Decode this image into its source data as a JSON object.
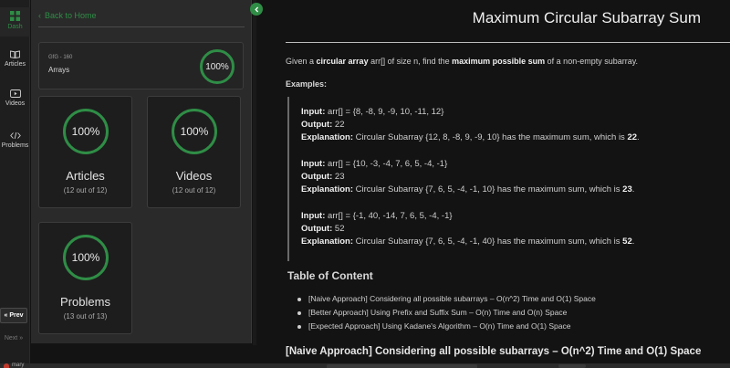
{
  "rail": {
    "items": [
      {
        "label": "Dash",
        "icon": "grid-icon"
      },
      {
        "label": "Articles",
        "icon": "book-icon"
      },
      {
        "label": "Videos",
        "icon": "play-icon"
      },
      {
        "label": "Problems",
        "icon": "code-icon"
      }
    ],
    "prev_label": "Prev",
    "next_label": "Next"
  },
  "panel": {
    "back_label": "Back to Home",
    "course": {
      "code": "GfG - 160",
      "name": "Arrays",
      "progress": "100%"
    },
    "stats": [
      {
        "progress": "100%",
        "title": "Articles",
        "subtitle": "(12 out of 12)"
      },
      {
        "progress": "100%",
        "title": "Videos",
        "subtitle": "(12 out of 12)"
      },
      {
        "progress": "100%",
        "title": "Problems",
        "subtitle": "(13 out of 13)"
      }
    ]
  },
  "article": {
    "title": "Maximum Circular Subarray Sum",
    "intro": {
      "p1": "Given a ",
      "b1": "circular array",
      "p2": " arr[] of size n, find the ",
      "b2": "maximum possible sum",
      "p3": " of a non-empty subarray."
    },
    "examples_label": "Examples:",
    "examples": [
      {
        "input_label": "Input:",
        "input": " arr[] = {8, -8, 9, -9, 10, -11, 12}",
        "output_label": "Output:",
        "output": " 22",
        "explanation_label": "Explanation:",
        "explanation": " Circular Subarray {12, 8, -8, 9, -9, 10} has the maximum sum, which is ",
        "answer": "22",
        "end": "."
      },
      {
        "input_label": "Input:",
        "input": " arr[] = {10, -3, -4, 7, 6, 5, -4, -1}",
        "output_label": "Output:",
        "output": " 23",
        "explanation_label": "Explanation:",
        "explanation": " Circular Subarray {7, 6, 5, -4, -1, 10} has the maximum sum, which is ",
        "answer": "23",
        "end": "."
      },
      {
        "input_label": "Input:",
        "input": " arr[] = {-1, 40, -14, 7, 6, 5, -4, -1}",
        "output_label": "Output:",
        "output": " 52",
        "explanation_label": "Explanation:",
        "explanation": " Circular Subarray {7, 6, 5, -4, -1, 40} has the maximum sum, which is ",
        "answer": "52",
        "end": "."
      }
    ],
    "toc_title": "Table of Content",
    "toc": [
      "[Naive Approach] Considering all possible subarrays – O(n^2) Time and O(1) Space",
      "[Better Approach] Using Prefix and Suffix Sum – O(n) Time and O(n) Space",
      "[Expected Approach] Using Kadane's Algorithm – O(n) Time and O(1) Space"
    ],
    "section_heading": "[Naive Approach] Considering all possible subarrays – O(n^2) Time and O(1) Space"
  },
  "taskbar": {
    "label": "mary"
  },
  "colors": {
    "accent": "#2f8d46",
    "background": "#131313",
    "panel": "#2a2a2a"
  }
}
